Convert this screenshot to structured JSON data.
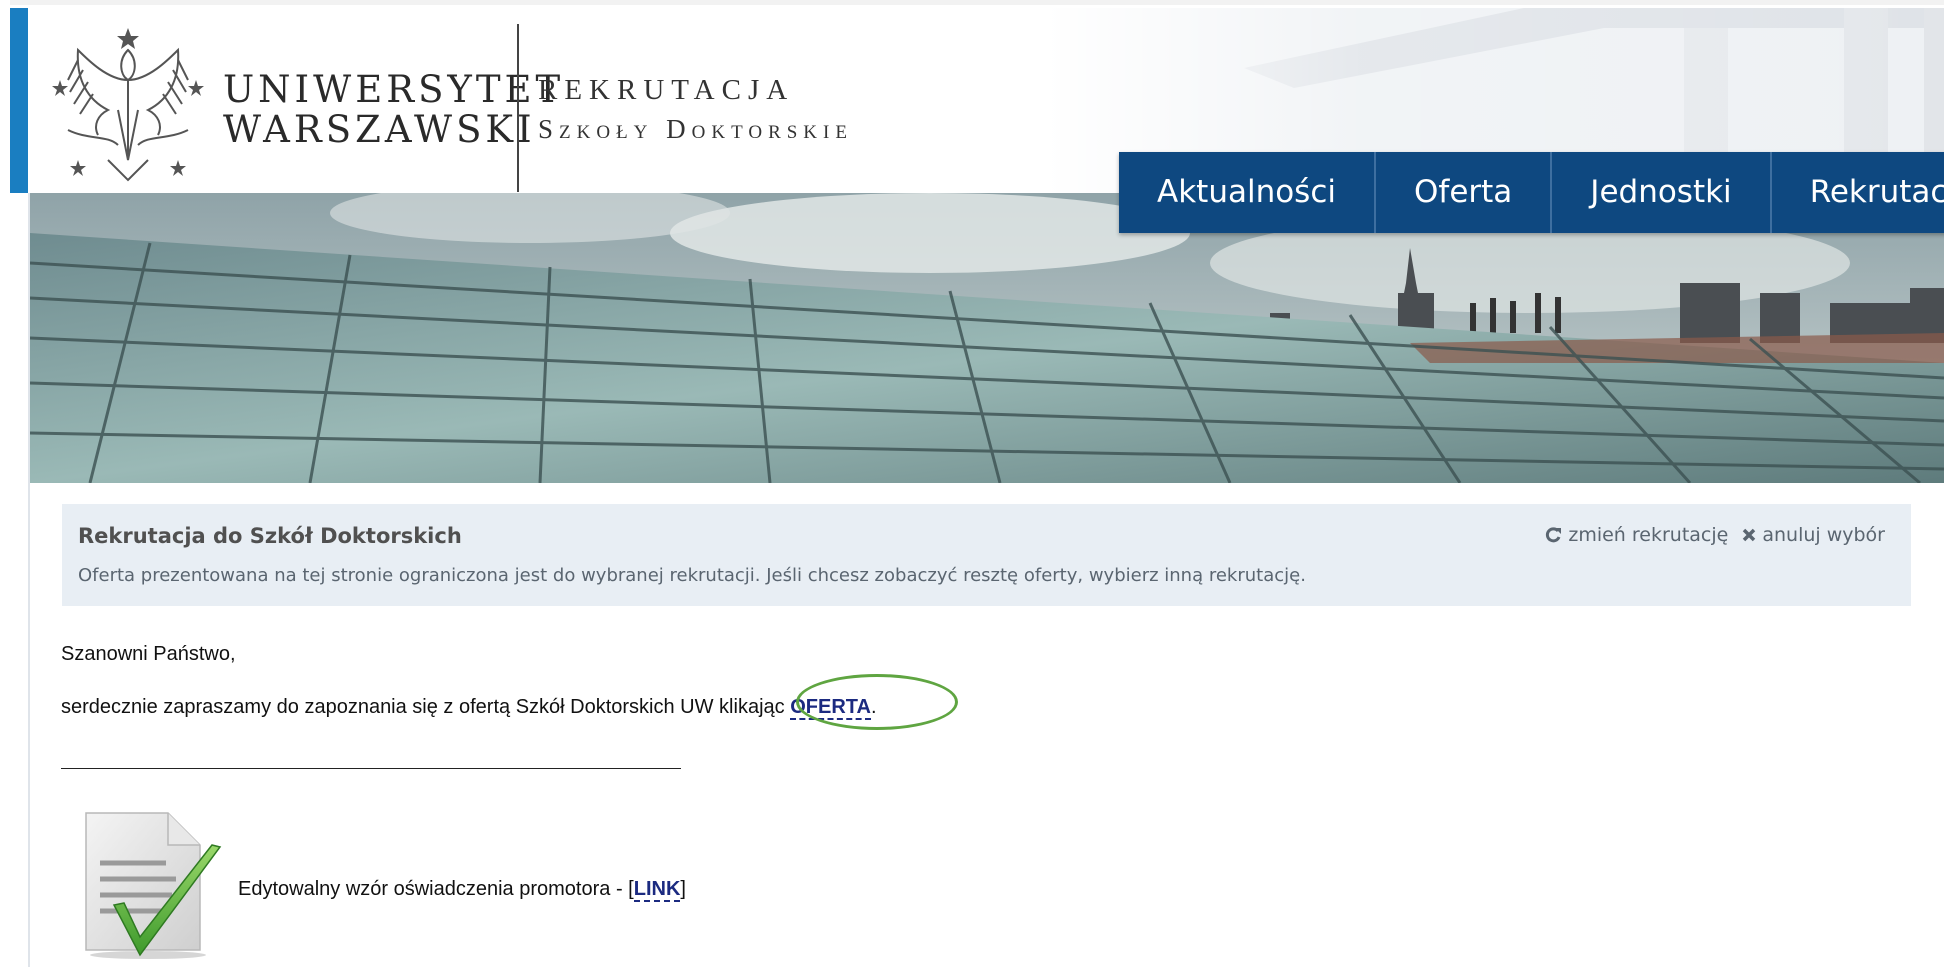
{
  "header": {
    "university_line1": "UNIWERSYTET",
    "university_line2": "WARSZAWSKI",
    "section_title": "REKRUTACJA",
    "section_subtitle": "Szkoły Doktorskie"
  },
  "nav": {
    "items": [
      {
        "label": "Aktualności"
      },
      {
        "label": "Oferta"
      },
      {
        "label": "Jednostki"
      },
      {
        "label": "Rekrutacja"
      }
    ],
    "color": "#0e4880"
  },
  "info_box": {
    "title": "Rekrutacja do Szkół Doktorskich",
    "description": "Oferta prezentowana na tej stronie ograniczona jest do wybranej rekrutacji. Jeśli chcesz zobaczyć resztę oferty, wybierz inną rekrutację.",
    "change_label": "zmień rekrutację",
    "cancel_label": "anuluj wybór"
  },
  "content": {
    "greeting": "Szanowni Państwo,",
    "invite_text": "serdecznie zapraszamy do zapoznania się z ofertą Szkół Doktorskich UW klikając ",
    "offer_link": "OFERTA",
    "invite_end": ".",
    "doc_text": "Edytowalny wzór oświadczenia promotora - ",
    "doc_bracket_open": "[",
    "doc_link": "LINK",
    "doc_bracket_close": "]"
  },
  "colors": {
    "accent": "#1a7ec1",
    "link": "#1b2a80",
    "highlight": "#5fa541"
  }
}
